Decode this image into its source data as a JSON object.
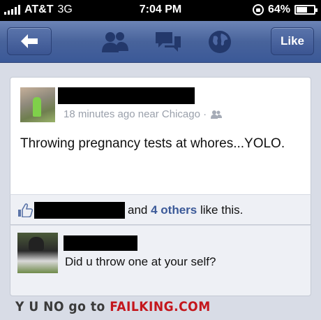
{
  "status_bar": {
    "carrier": "AT&T",
    "network": "3G",
    "time": "7:04 PM",
    "battery": "64%",
    "battery_level": 0.64
  },
  "nav_bar": {
    "like_label": "Like",
    "icons": [
      "back-arrow-icon",
      "friends-icon",
      "messages-icon",
      "globe-icon"
    ]
  },
  "post": {
    "meta": "18 minutes ago near Chicago ·",
    "text": "Throwing pregnancy tests at whores...YOLO."
  },
  "likes": {
    "and": "and",
    "others": "4 others",
    "suffix": "like this."
  },
  "comment": {
    "text": "Did u throw one at your self?"
  },
  "footer": {
    "prefix": "Y U NO go to",
    "brand": "FAILKING.COM"
  },
  "colors": {
    "nav_blue": "#3b5998",
    "link_blue": "#3b5998",
    "brand_red": "#c4161c"
  }
}
